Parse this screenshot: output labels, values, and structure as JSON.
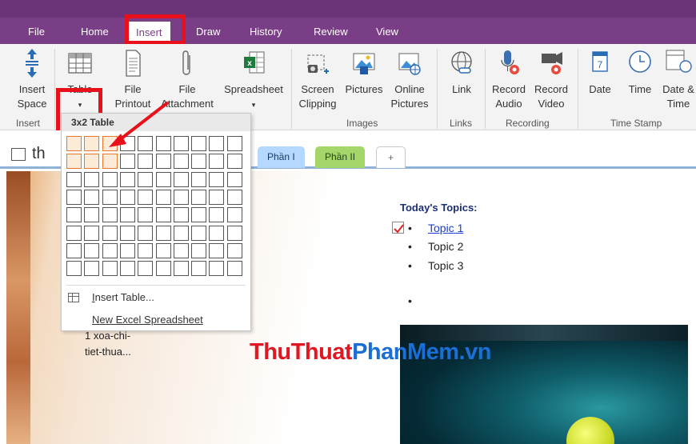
{
  "ribbon_tabs": [
    {
      "label": "File"
    },
    {
      "label": "Home"
    },
    {
      "label": "Insert"
    },
    {
      "label": "Draw"
    },
    {
      "label": "History"
    },
    {
      "label": "Review"
    },
    {
      "label": "View"
    }
  ],
  "ribbon": {
    "insert_space": {
      "line1": "Insert",
      "line2": "Space"
    },
    "table": {
      "label": "Table",
      "arrow": "▾"
    },
    "file_printout": {
      "line1": "File",
      "line2": "Printout"
    },
    "file_attachment": {
      "line1": "File",
      "line2": "Attachment"
    },
    "spreadsheet": {
      "label": "Spreadsheet",
      "arrow": "▾"
    },
    "screen_clipping": {
      "line1": "Screen",
      "line2": "Clipping"
    },
    "pictures": {
      "label": "Pictures"
    },
    "online_pictures": {
      "line1": "Online",
      "line2": "Pictures"
    },
    "link": {
      "label": "Link"
    },
    "record_audio": {
      "line1": "Record",
      "line2": "Audio"
    },
    "record_video": {
      "line1": "Record",
      "line2": "Video"
    },
    "date": {
      "label": "Date"
    },
    "time": {
      "label": "Time"
    },
    "date_time": {
      "line1": "Date &",
      "line2": "Time"
    },
    "groups": {
      "insert": "Insert",
      "images": "Images",
      "links": "Links",
      "recording": "Recording",
      "time_stamp": "Time Stamp"
    }
  },
  "notebook": {
    "title_partial": "th",
    "section_tabs": [
      {
        "label": "Phần I"
      },
      {
        "label": "Phần II"
      },
      {
        "label": "+"
      }
    ]
  },
  "table_dropdown": {
    "title": "3x2 Table",
    "selected_cols": 3,
    "selected_rows": 2,
    "grid_cols": 10,
    "grid_rows": 8,
    "insert_table": {
      "underlined": "I",
      "rest": "nsert Table..."
    },
    "new_excel": {
      "underlined": "N",
      "rest": "ew Excel Spreadsheet"
    }
  },
  "page": {
    "left_text": [
      "1 xoa-chi-",
      "tiet-thua..."
    ],
    "topics_title": "Today's Topics:",
    "topics": [
      {
        "label": "Topic 1",
        "checked": true
      },
      {
        "label": "Topic 2"
      },
      {
        "label": "Topic 3"
      },
      {
        "label": ""
      }
    ]
  },
  "watermark": {
    "part1": "ThuThuat",
    "part2": "PhanMem.vn"
  },
  "colors": {
    "brand": "#7a3e86",
    "highlight": "#e8101a",
    "selection": "#e8762d",
    "section_active": "#b4d8ff",
    "section_second": "#a5d66a"
  }
}
